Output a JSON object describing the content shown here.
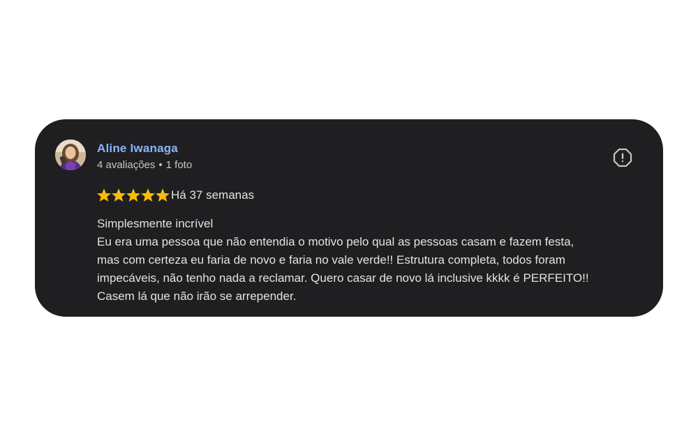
{
  "review": {
    "author": {
      "name": "Aline Iwanaga",
      "reviews_count": "4 avaliações",
      "separator": "•",
      "photos_count": "1 foto",
      "avatar_icon": "user-avatar-photo"
    },
    "report_icon": "report-flag-icon",
    "rating": {
      "stars": 5,
      "max": 5,
      "star_color": "#f9bb0a"
    },
    "time_ago": "Há 37 semanas",
    "text_lines": [
      "Simplesmente incrível",
      "Eu era uma pessoa que não entendia o motivo pelo qual as pessoas casam e fazem festa,",
      "mas com certeza eu faria de novo e faria no vale verde!! Estrutura completa, todos foram",
      "impecáveis, não tenho nada a reclamar. Quero casar de novo lá inclusive kkkk é PERFEITO!!",
      "Casem lá que não irão se arrepender."
    ]
  },
  "colors": {
    "card_background": "#1f1f22",
    "author_name": "#8ab4f8",
    "text": "#e3e3e3",
    "meta_text": "#c4c7c5"
  }
}
